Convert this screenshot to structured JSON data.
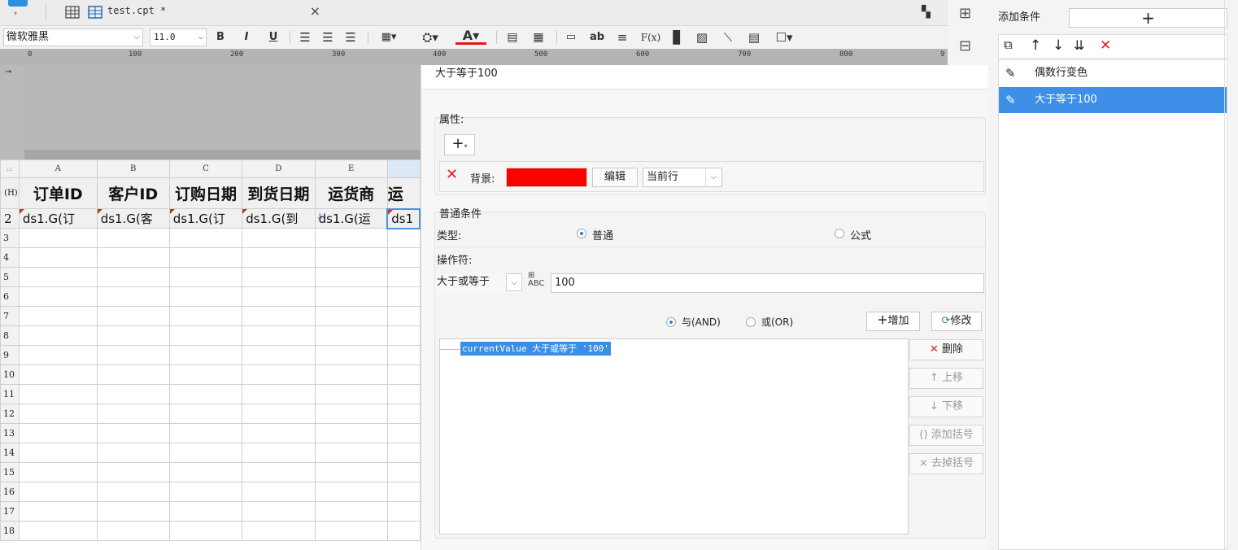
{
  "tabbar": {
    "file_tab": {
      "title": "test.cpt *",
      "close": "×"
    }
  },
  "format_toolbar": {
    "font_name": "微软雅黑",
    "font_size": "11.0",
    "bold": "B",
    "italic": "I",
    "underline": "U",
    "text_tool": "ab",
    "formula_tool": "F(x)"
  },
  "ruler": {
    "ticks": [
      "0",
      "100",
      "200",
      "300",
      "400",
      "500",
      "600",
      "700",
      "800",
      "9"
    ]
  },
  "sheet": {
    "corner": ":::",
    "columns": [
      "A",
      "B",
      "C",
      "D",
      "E",
      ""
    ],
    "row_header_label": "(H)",
    "header_row": [
      "订单ID",
      "客户ID",
      "订购日期",
      "到货日期",
      "运货商",
      "运"
    ],
    "data_row": [
      "ds1.G(订",
      "ds1.G(客",
      "ds1.G(订",
      "ds1.G(到",
      "ds1.G(运",
      "ds1"
    ],
    "row_numbers": [
      "2",
      "3",
      "4",
      "5",
      "6",
      "7",
      "8",
      "9",
      "10",
      "11",
      "12",
      "13",
      "14",
      "15",
      "16",
      "17",
      "18"
    ]
  },
  "dialog": {
    "title": "大于等于100",
    "attributes": {
      "label": "属性:",
      "add_symbol": "+",
      "background_label": "背景:",
      "background_color": "#ff0000",
      "edit_button": "编辑",
      "scope_select": "当前行"
    },
    "common": {
      "section_label": "普通条件",
      "type_label": "类型:",
      "type_normal": "普通",
      "type_formula": "公式",
      "operator_label": "操作符:",
      "operator_value": "大于或等于",
      "value_input": "100"
    },
    "logic": {
      "and_label": "与(AND)",
      "or_label": "或(OR)",
      "add_button": "增加",
      "modify_button": "修改"
    },
    "conditions": [
      "currentValue 大于或等于 '100'"
    ],
    "side_buttons": {
      "delete": "删除",
      "move_up": "上移",
      "move_down": "下移",
      "add_paren": "添加括号",
      "remove_paren": "去掉括号"
    }
  },
  "condition_pane": {
    "add_label": "添加条件",
    "add_button": "+",
    "items": [
      {
        "label": "偶数行变色",
        "active": false
      },
      {
        "label": "大于等于100",
        "active": true
      }
    ]
  }
}
